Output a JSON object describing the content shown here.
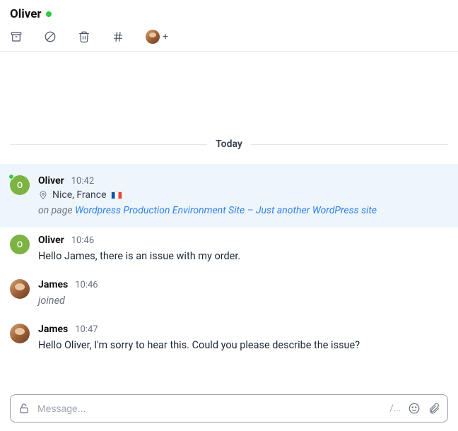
{
  "header": {
    "title": "Oliver"
  },
  "toolbar": {
    "add_plus": "+"
  },
  "divider": {
    "label": "Today"
  },
  "messages": [
    {
      "author": "Oliver",
      "time": "10:42",
      "avatar_initial": "O",
      "location": "Nice, France",
      "page_prefix": "on page ",
      "page_link": "Wordpress Production Environment Site – Just another WordPress site"
    },
    {
      "author": "Oliver",
      "time": "10:46",
      "avatar_initial": "O",
      "text": "Hello James, there is an issue with my order."
    },
    {
      "author": "James",
      "time": "10:46",
      "text": "joined"
    },
    {
      "author": "James",
      "time": "10:47",
      "text": "Hello Oliver, I'm sorry to hear this. Could you please describe the issue?"
    }
  ],
  "composer": {
    "placeholder": "Message...",
    "slash": "/..."
  }
}
